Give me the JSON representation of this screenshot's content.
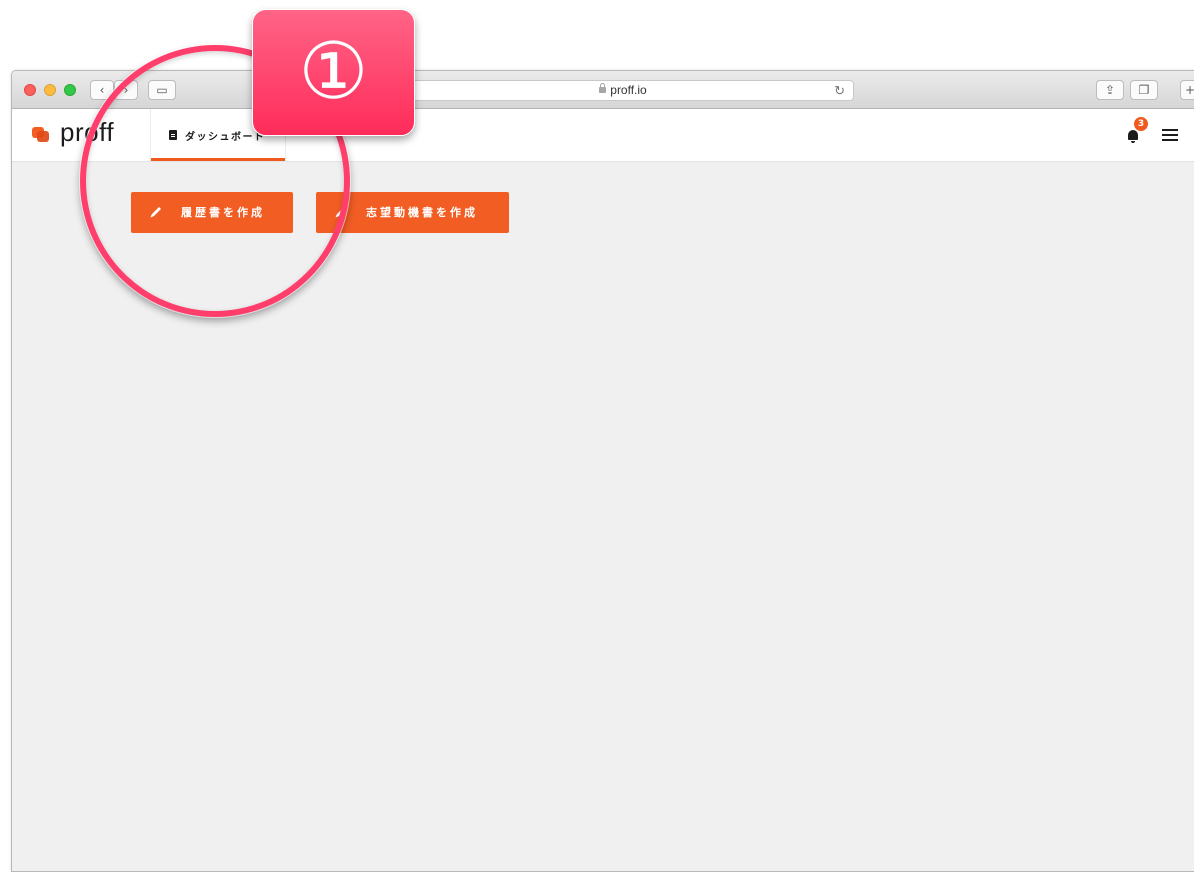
{
  "browser": {
    "url": "proff.io",
    "nav_back": "‹",
    "nav_forward": "›",
    "sidebar_toggle": "▭",
    "reload": "↻",
    "share": "⇪",
    "tabs_overview": "❐",
    "new_tab": "+"
  },
  "app": {
    "logo": "proff",
    "tab_dashboard": "ダッシュボード",
    "notifications_count": "3"
  },
  "actions": {
    "create_resume": "履歴書を作成",
    "create_motivation": "志望動機書を作成"
  },
  "annotation": {
    "step_number": "①"
  },
  "colors": {
    "accent": "#f25d24",
    "annotation": "#ff3e6c"
  }
}
